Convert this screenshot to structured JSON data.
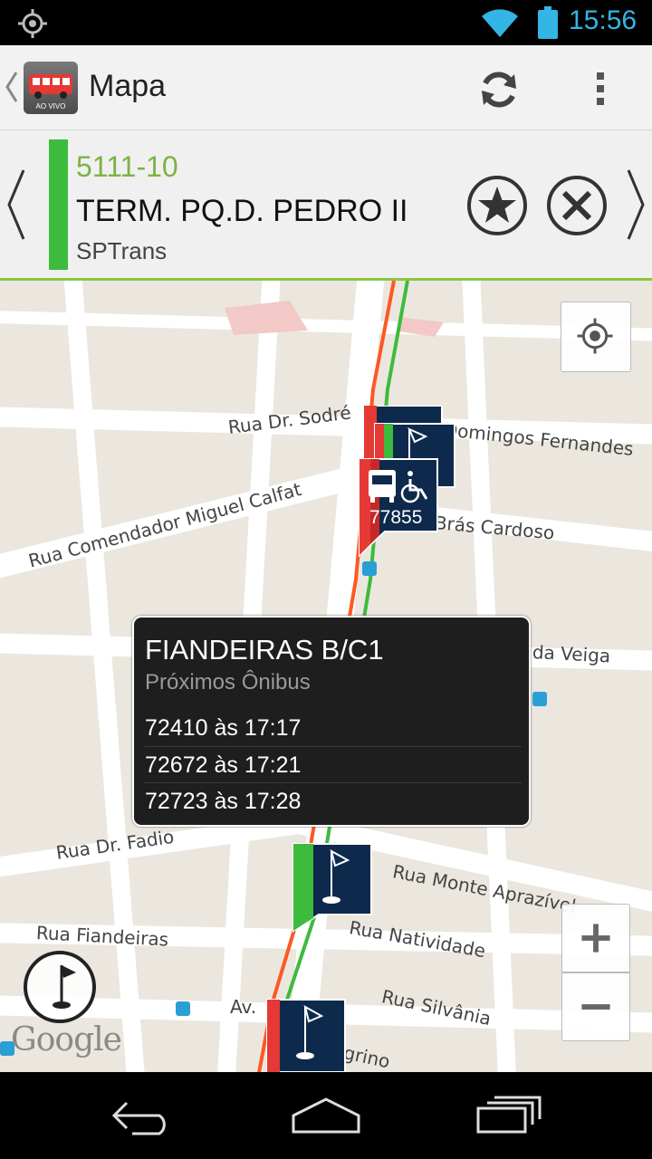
{
  "status_bar": {
    "time": "15:56",
    "icons": [
      "gps-icon",
      "wifi-icon",
      "battery-icon"
    ],
    "accent_color": "#33b5e5"
  },
  "action_bar": {
    "title": "Mapa",
    "logo_text": "AO VIVO",
    "actions": [
      "refresh-icon",
      "overflow-menu-icon"
    ]
  },
  "line": {
    "code": "5111-10",
    "destination": "TERM. PQ.D. PEDRO II",
    "operator": "SPTrans",
    "color": "#3dbb3d",
    "code_color": "#7cb342"
  },
  "map": {
    "streets": [
      "Rua Dr. Sodré",
      "Domingos Fernandes",
      "Rua Comendador Miguel Calfat",
      "Brás Cardoso",
      "da Veiga",
      "Rua Dr. Fadio",
      "Rua Monte Aprazível",
      "Rua Fiandeiras",
      "Rua Natividade",
      "Rua Silvânia",
      "Av.",
      "grino"
    ],
    "bus_marker": {
      "number": "77855",
      "accessible": true
    },
    "attribution": "Google",
    "controls": {
      "zoom_in": "+",
      "zoom_out": "−"
    }
  },
  "info_window": {
    "stop_name": "FIANDEIRAS B/C1",
    "subtitle": "Próximos Ônibus",
    "arrivals": [
      "72410 às 17:17",
      "72672 às 17:21",
      "72723 às 17:28"
    ]
  },
  "nav_bar": {
    "buttons": [
      "back-icon",
      "home-icon",
      "recent-apps-icon"
    ]
  }
}
